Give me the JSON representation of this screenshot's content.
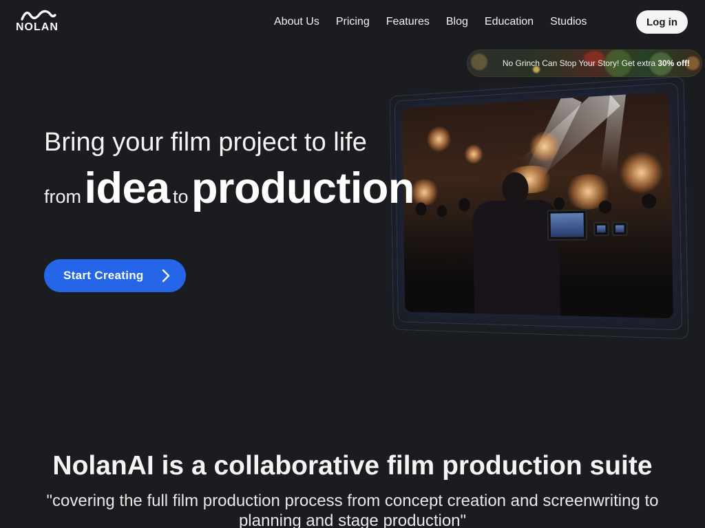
{
  "brand": {
    "name": "NOLAN",
    "logo_icon": "wave-logo-icon"
  },
  "nav": {
    "items": [
      "About Us",
      "Pricing",
      "Features",
      "Blog",
      "Education",
      "Studios"
    ],
    "login_label": "Log in"
  },
  "promo": {
    "text": "No Grinch Can Stop Your Story! Get extra ",
    "highlight": "30% off!"
  },
  "hero": {
    "line1": "Bring your film project to life",
    "from": "from",
    "idea": "idea",
    "to": "to",
    "production": "production",
    "cta_label": "Start Creating",
    "cta_icon": "chevron-right-icon"
  },
  "section": {
    "title": "NolanAI is a collaborative film production suite",
    "subtitle": "\"covering the full film production process from concept creation and screenwriting to planning and stage production\""
  },
  "colors": {
    "background": "#1b1c20",
    "accent": "#2566e8",
    "login_bg": "#f4f4f6"
  }
}
